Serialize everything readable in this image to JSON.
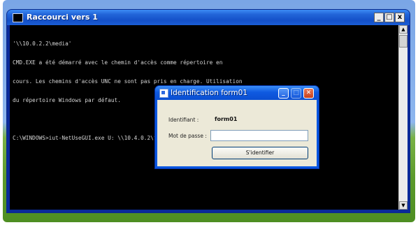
{
  "console": {
    "title": "Raccourci vers 1",
    "controls": {
      "minimize": "_",
      "maximize": "□",
      "close": "x"
    },
    "lines": [
      "'\\\\10.0.2.2\\media'",
      "CMD.EXE a été démarré avec le chemin d'accès comme répertoire en",
      "cours. Les chemins d'accès UNC ne sont pas pris en charge. Utilisation",
      "du répertoire Windows par défaut.",
      "",
      "C:\\WINDOWS>iut-NetUseGUI.exe U: \\\\10.4.0.2\\form01 /USER:form01"
    ]
  },
  "dialog": {
    "title": "Identification form01",
    "username_label": "Identifiant :",
    "username_value": "form01",
    "password_label": "Mot de passe :",
    "password_value": "",
    "submit_label": "S'identifier"
  }
}
